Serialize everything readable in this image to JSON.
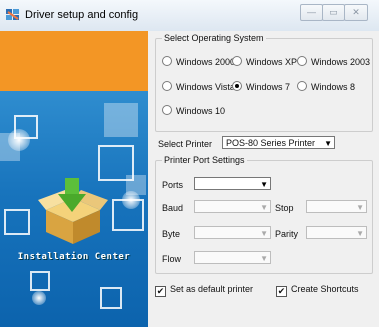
{
  "window": {
    "title": "Driver setup and config",
    "min": "—",
    "max": "▭",
    "close": "✕"
  },
  "banner": {
    "text": "Installation Center"
  },
  "os_group": {
    "title": "Select Operating System",
    "options": [
      "Windows 2000",
      "Windows XP",
      "Windows 2003",
      "Windows Vista",
      "Windows 7",
      "Windows 8",
      "Windows 10"
    ],
    "selected": "Windows 7"
  },
  "printer": {
    "label": "Select Printer",
    "value": "POS-80 Series Printer"
  },
  "port_group": {
    "title": "Printer Port Settings",
    "ports_label": "Ports",
    "ports_value": "",
    "baud_label": "Baud",
    "stop_label": "Stop",
    "byte_label": "Byte",
    "parity_label": "Parity",
    "flow_label": "Flow"
  },
  "checks": {
    "default_printer": {
      "label": "Set as default printer",
      "checked": true
    },
    "shortcuts": {
      "label": "Create Shortcuts",
      "checked": true
    }
  },
  "colors": {
    "orange": "#f39625",
    "banner_blue": "#1773bc"
  }
}
